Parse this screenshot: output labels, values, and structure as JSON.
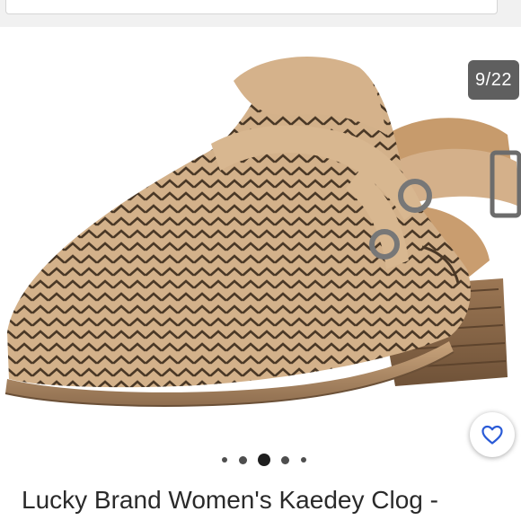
{
  "gallery": {
    "counter": "9/22",
    "current_index": 9,
    "total": 22,
    "image_alt_name": "shoe-photo",
    "dots_count": 5,
    "active_dot": 2
  },
  "listing": {
    "title": "Lucky Brand Women's Kaedey Clog -"
  },
  "icons": {
    "like": "heart-icon"
  },
  "colors": {
    "accent": "#2a5bd7",
    "suede": "#d2b08a"
  }
}
